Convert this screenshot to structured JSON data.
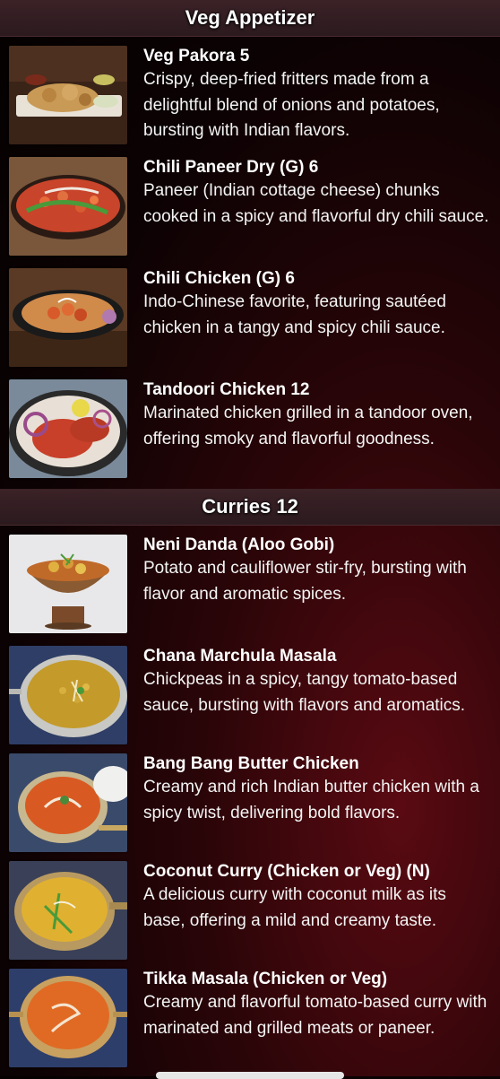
{
  "sections": [
    {
      "title": "Veg Appetizer",
      "items": [
        {
          "name": "Veg Pakora 5",
          "desc": "Crispy, deep-fried fritters made from a delightful blend of onions and potatoes, bursting with Indian flavors."
        },
        {
          "name": "Chili Paneer Dry (G) 6",
          "desc": "Paneer (Indian cottage cheese) chunks cooked in a spicy and flavorful dry chili sauce."
        },
        {
          "name": "Chili Chicken (G) 6",
          "desc": "Indo-Chinese favorite, featuring sautéed chicken in a tangy and spicy chili sauce."
        },
        {
          "name": "Tandoori Chicken 12",
          "desc": "Marinated chicken grilled in a tandoor oven, offering smoky and flavorful goodness."
        }
      ]
    },
    {
      "title": "Curries 12",
      "items": [
        {
          "name": "Neni Danda (Aloo Gobi)",
          "desc": "Potato and cauliflower stir-fry, bursting with flavor and aromatic spices."
        },
        {
          "name": "Chana Marchula Masala",
          "desc": "Chickpeas in a spicy, tangy tomato-based sauce, bursting with flavors and aromatics."
        },
        {
          "name": "Bang Bang Butter Chicken",
          "desc": "Creamy and rich Indian butter chicken with a spicy twist, delivering bold flavors."
        },
        {
          "name": "Coconut Curry (Chicken or Veg) (N)",
          "desc": "A delicious curry with coconut milk as its base, offering a mild and creamy taste."
        },
        {
          "name": "Tikka Masala (Chicken or Veg)",
          "desc": "Creamy and flavorful tomato-based curry with marinated and grilled meats or paneer."
        }
      ]
    }
  ]
}
